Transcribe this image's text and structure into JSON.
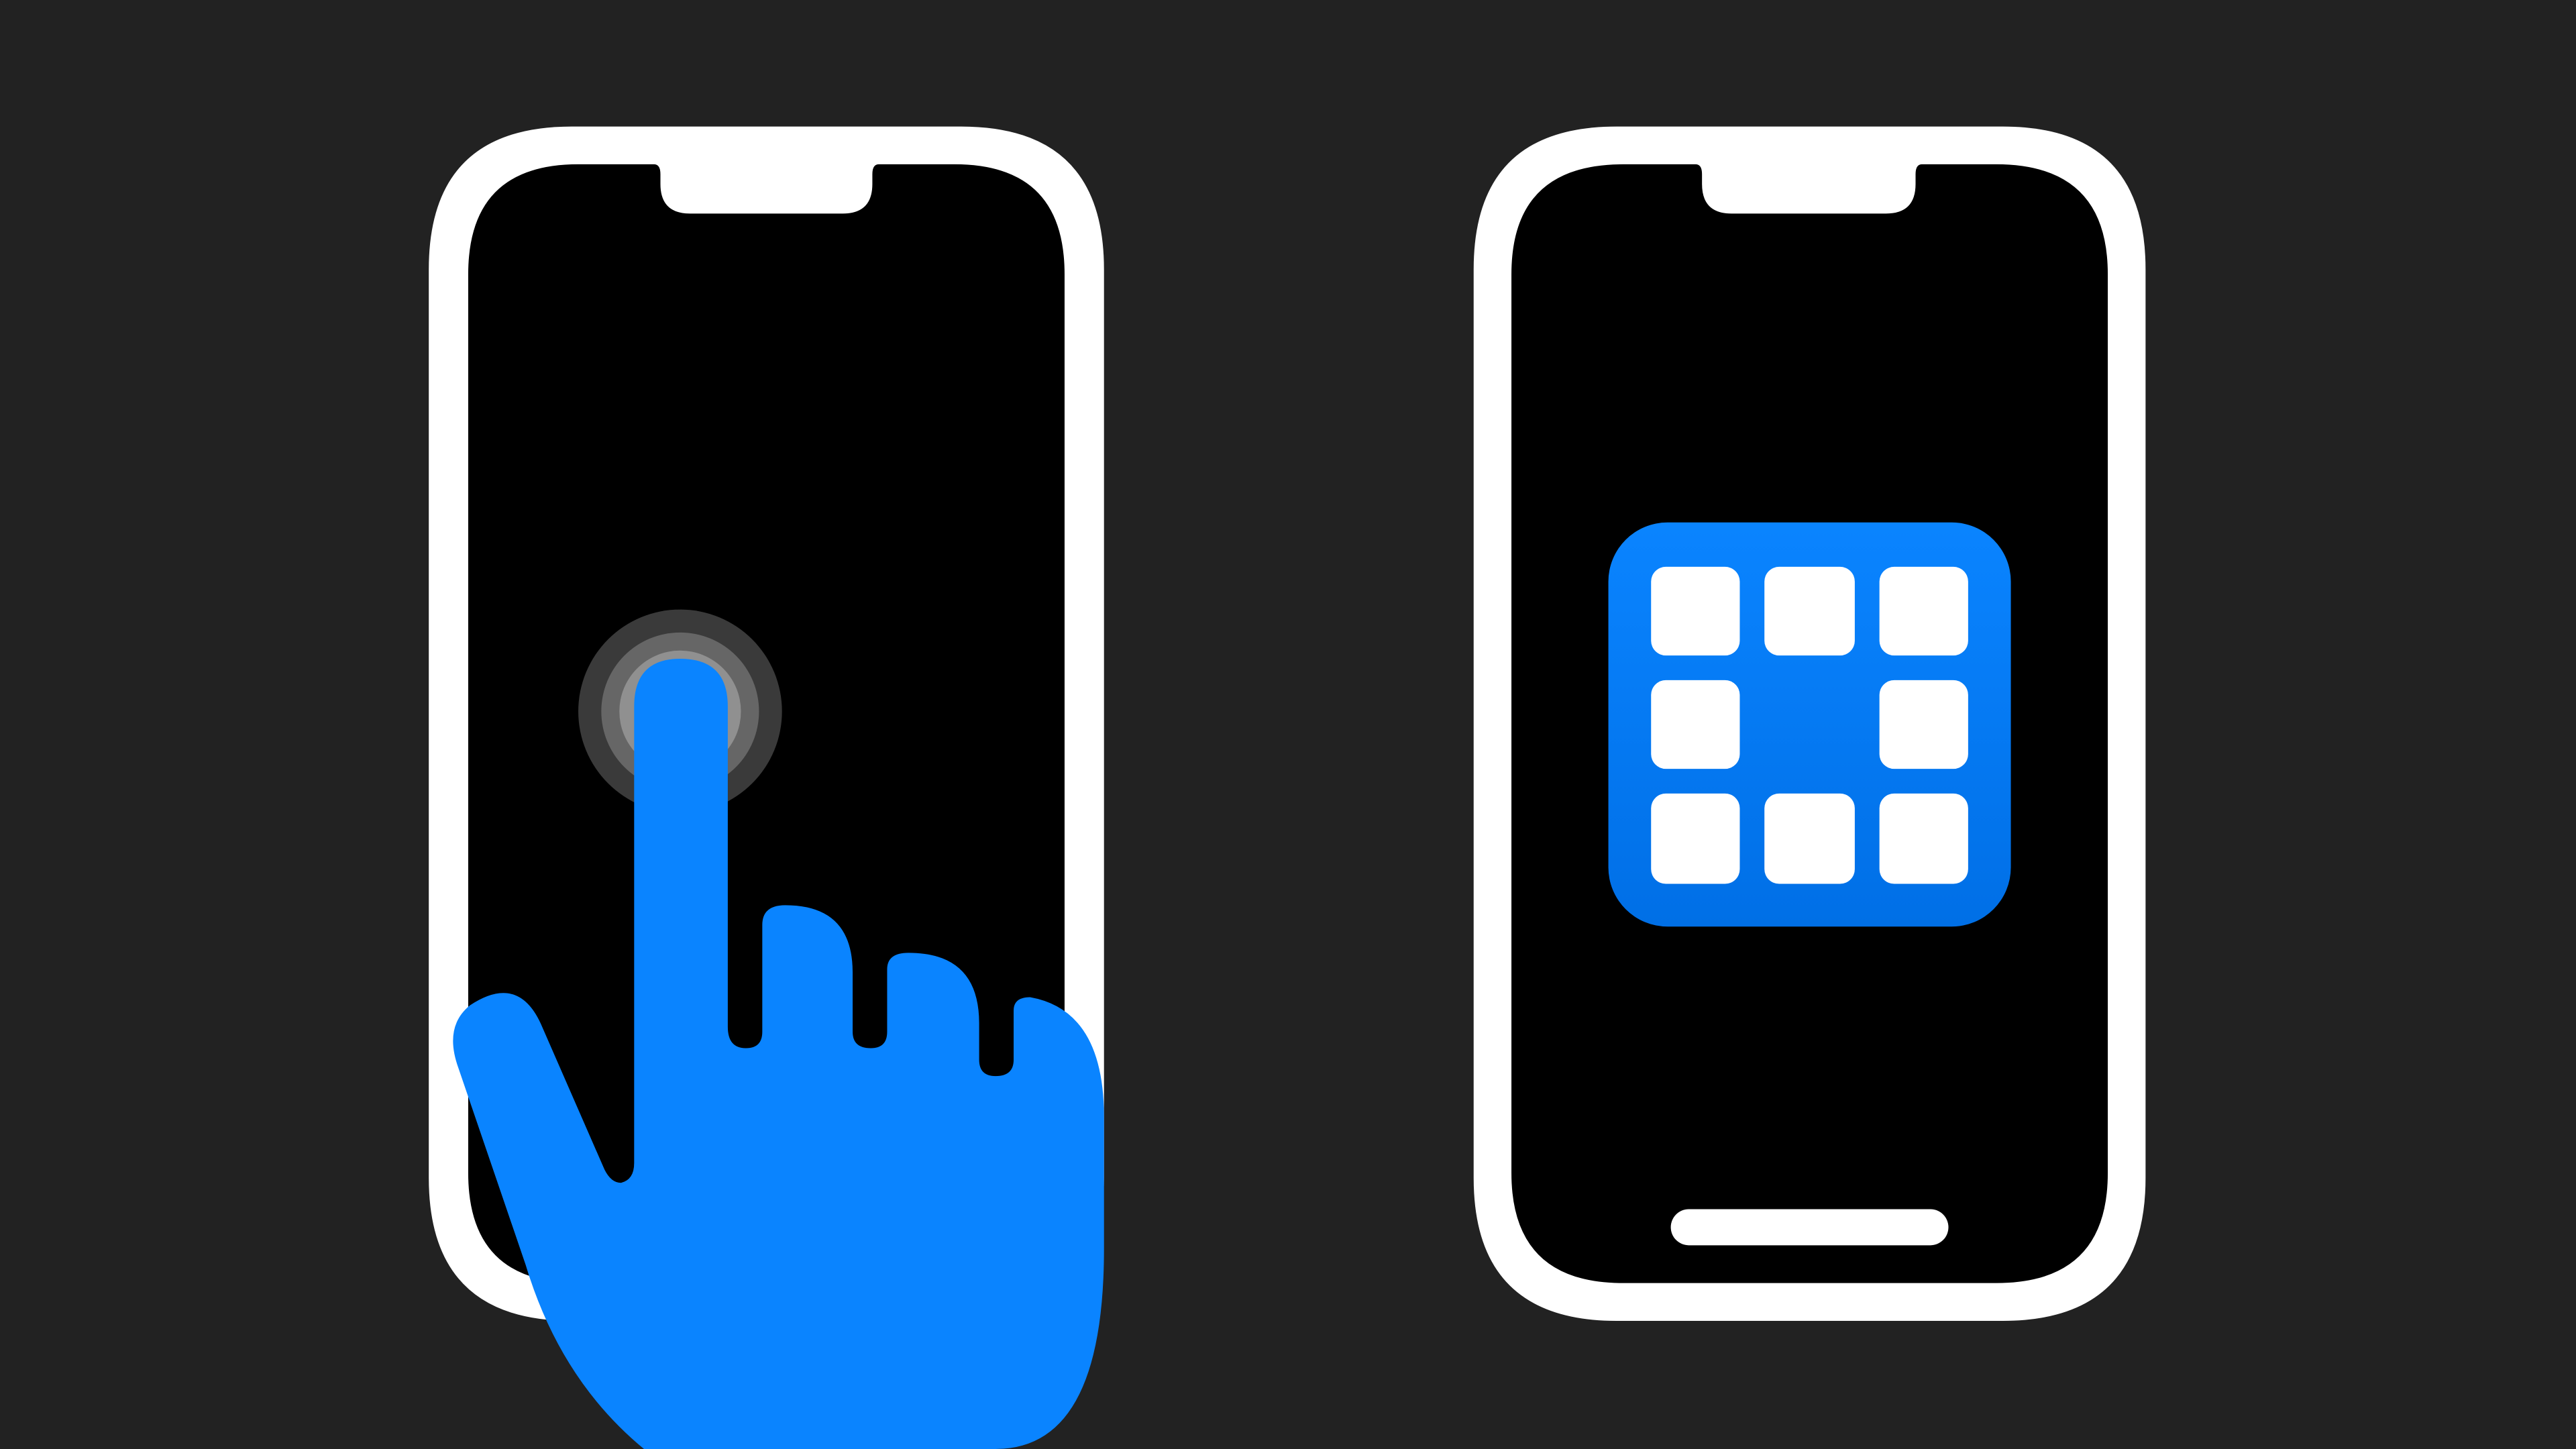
{
  "scene": {
    "background_color": "#222222",
    "phone_frame_color": "#ffffff",
    "phone_screen_color": "#000000",
    "accent_color": "#0a84ff",
    "touch_ring_outer_color": "#3a3a3a",
    "touch_ring_middle_color": "#666666",
    "touch_ring_inner_color": "#909090"
  },
  "left_phone": {
    "icon": "iphone-outline-icon",
    "gesture": "tap",
    "overlay_icon": "pointing-hand-icon",
    "touch_indicator_icon": "touch-ripple-icon"
  },
  "right_phone": {
    "icon": "iphone-outline-icon",
    "app_icon": "app-grid-icon",
    "app_grid_tiles": 8,
    "home_indicator_icon": "home-indicator-icon"
  }
}
